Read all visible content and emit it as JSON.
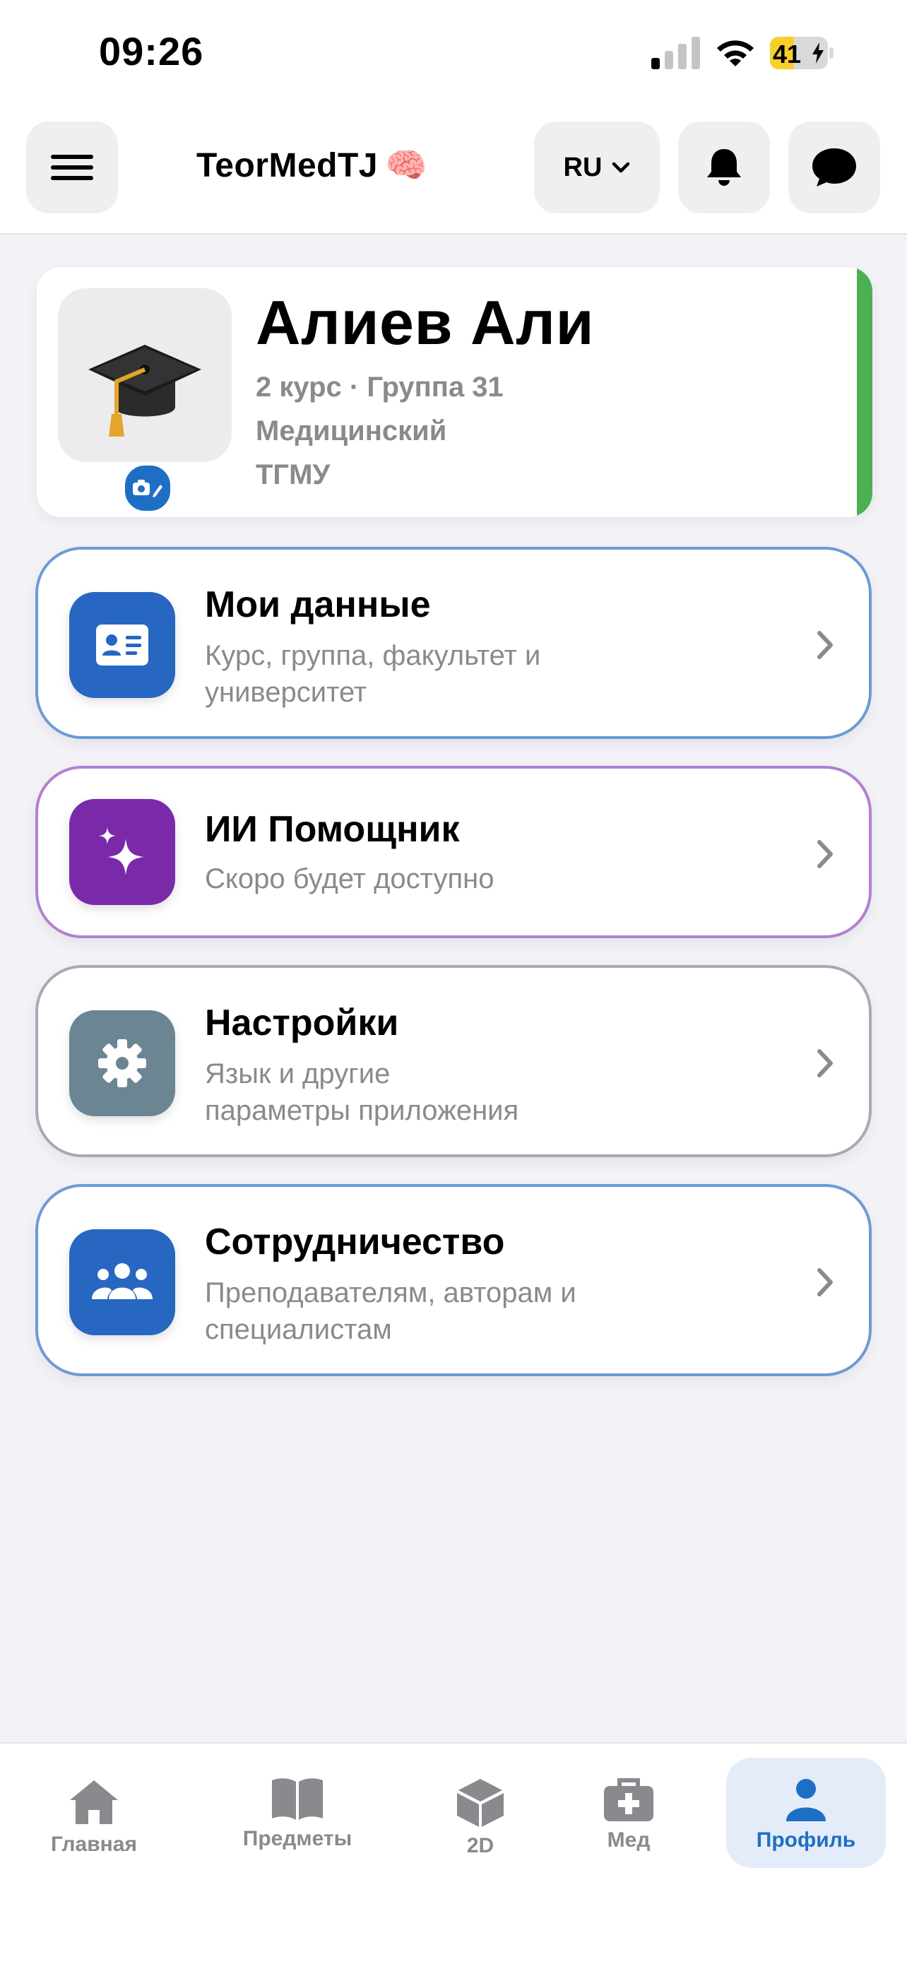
{
  "status_bar": {
    "time": "09:26",
    "battery": "41",
    "battery_level_percent": 41
  },
  "header": {
    "app_title": "TeorMedTJ",
    "app_emoji": "🧠",
    "language": "RU"
  },
  "profile": {
    "name": "Алиев Али",
    "course_group": "2 курс · Группа 31",
    "faculty": "Медицинский",
    "university": "ТГМУ",
    "accent_color": "#4caf50"
  },
  "menu": [
    {
      "title": "Мои данные",
      "subtitle_line1": "Курс, группа, факультет и",
      "subtitle_line2": "университет",
      "color": "#2767c2",
      "border": "#6d9ad6",
      "icon": "id-card-icon"
    },
    {
      "title": "ИИ Помощник",
      "subtitle_line1": "Скоро будет доступно",
      "subtitle_line2": "",
      "color": "#7a2aa8",
      "border": "#b27fd1",
      "icon": "sparkles-icon"
    },
    {
      "title": "Настройки",
      "subtitle_line1": "Язык и другие",
      "subtitle_line2": "параметры приложения",
      "color": "#6c8592",
      "border": "#a4acb3",
      "icon": "gear-icon"
    },
    {
      "title": "Сотрудничество",
      "subtitle_line1": "Преподавателям, авторам и",
      "subtitle_line2": "специалистам",
      "color": "#2767c2",
      "border": "#6d9ad6",
      "icon": "people-icon"
    }
  ],
  "tabs": [
    {
      "label": "Главная",
      "icon": "home-icon"
    },
    {
      "label": "Предметы",
      "icon": "book-icon"
    },
    {
      "label": "2D",
      "icon": "cube-icon"
    },
    {
      "label": "Мед",
      "icon": "medkit-icon"
    },
    {
      "label": "Профиль",
      "icon": "person-icon",
      "active": true
    }
  ]
}
